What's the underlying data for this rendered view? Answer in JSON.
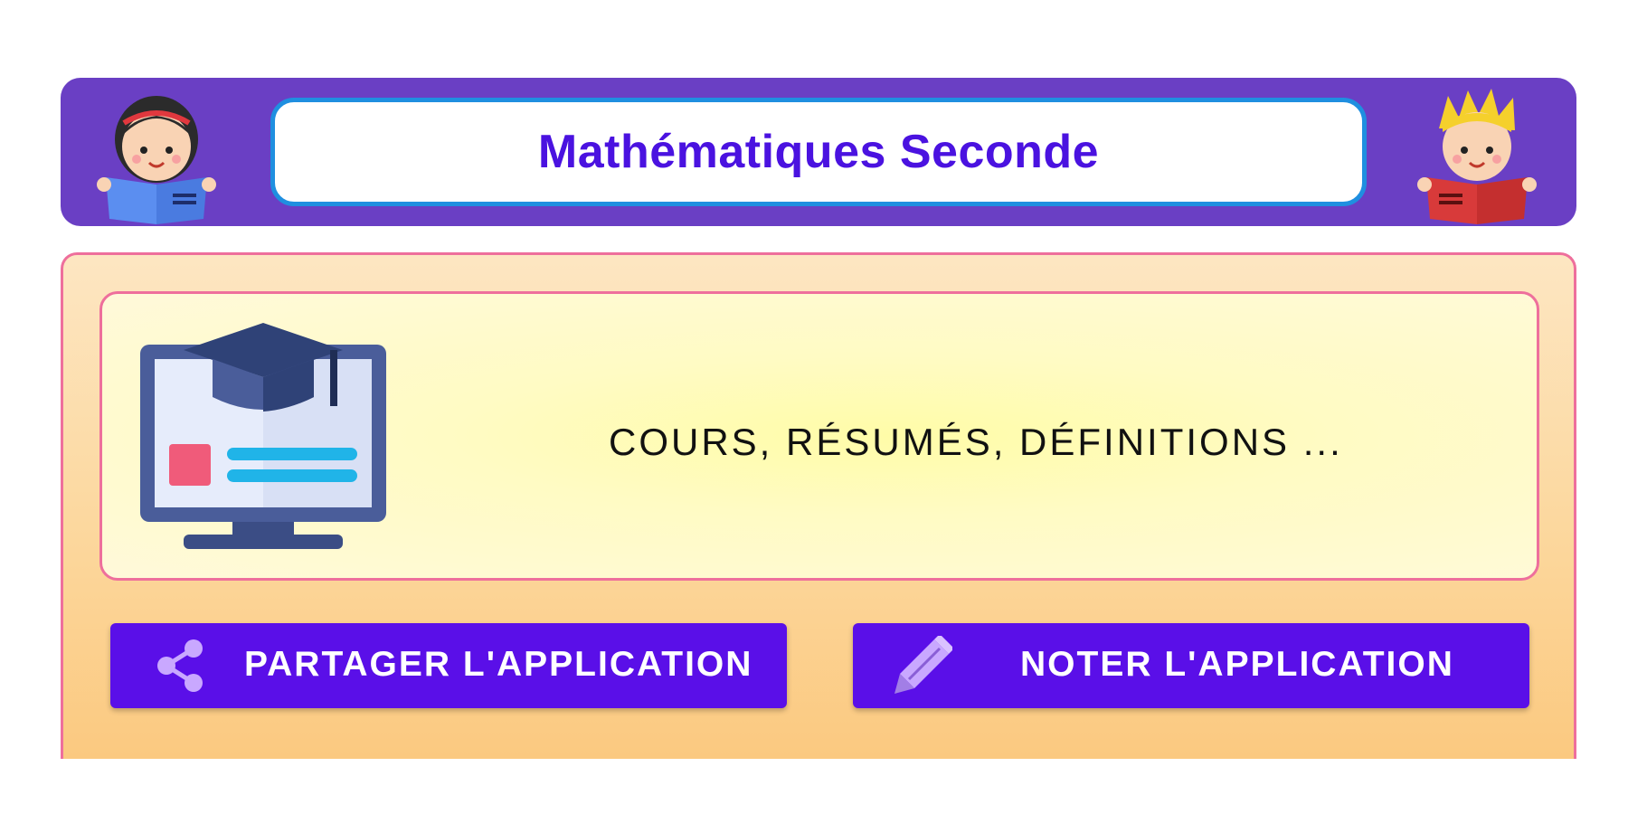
{
  "header": {
    "title": "Mathématiques Seconde",
    "left_icon": "girl-reading-book-icon",
    "right_icon": "boy-reading-book-icon",
    "background_color": "#6a3fc4",
    "title_color": "#4a12e0"
  },
  "card": {
    "icon": "graduation-monitor-icon",
    "label": "COURS, RÉSUMÉS, DÉFINITIONS ..."
  },
  "buttons": {
    "share_label": "PARTAGER L'APPLICATION",
    "share_icon": "share-icon",
    "rate_label": "NOTER L'APPLICATION",
    "rate_icon": "pencil-icon",
    "color": "#5a0fe8"
  }
}
